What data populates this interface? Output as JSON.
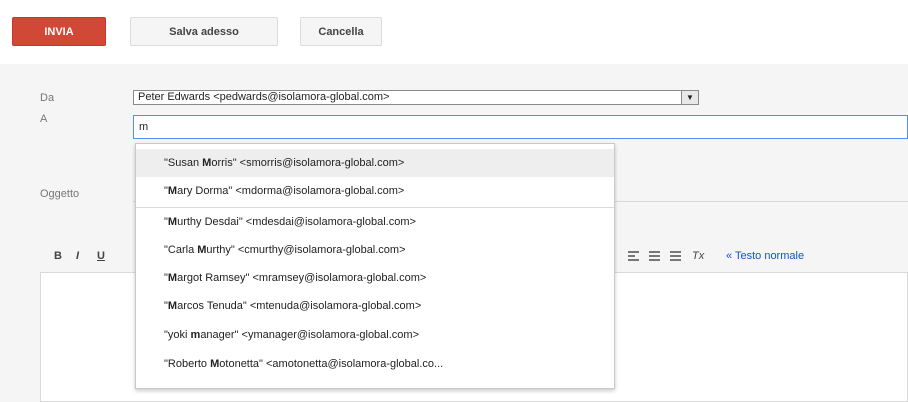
{
  "toolbar": {
    "send_label": "INVIA",
    "save_label": "Salva adesso",
    "cancel_label": "Cancella"
  },
  "form": {
    "from_label": "Da",
    "from_value": "Peter Edwards <pedwards@isolamora-global.com>",
    "to_label": "A",
    "to_value": "m",
    "subject_label": "Oggetto"
  },
  "formatting": {
    "bold": "B",
    "italic": "I",
    "underline": "U",
    "clear_format": "Tx",
    "text_style": "« Testo normale"
  },
  "suggestions": [
    {
      "pre": "\"Susan ",
      "match": "M",
      "post": "orris\" <smorris@isolamora-global.com>"
    },
    {
      "pre": "\"",
      "match": "M",
      "post": "ary Dorma\" <mdorma@isolamora-global.com>"
    },
    {
      "pre": "\"",
      "match": "M",
      "post": "urthy Desdai\" <mdesdai@isolamora-global.com>"
    },
    {
      "pre": "\"Carla ",
      "match": "M",
      "post": "urthy\" <cmurthy@isolamora-global.com>"
    },
    {
      "pre": "\"",
      "match": "M",
      "post": "argot Ramsey\" <mramsey@isolamora-global.com>"
    },
    {
      "pre": "\"",
      "match": "M",
      "post": "arcos Tenuda\" <mtenuda@isolamora-global.com>"
    },
    {
      "pre": "\"yoki ",
      "match": "m",
      "post": "anager\" <ymanager@isolamora-global.com>"
    },
    {
      "pre": "\"Roberto ",
      "match": "M",
      "post": "otonetta\" <amotonetta@isolamora-global.co..."
    }
  ]
}
